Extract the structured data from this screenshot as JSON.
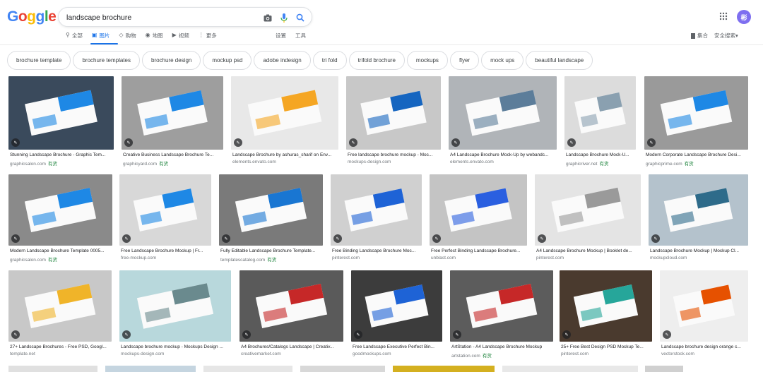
{
  "header": {
    "logo_letters": [
      "G",
      "o",
      "g",
      "g",
      "l",
      "e"
    ],
    "logo_colors": [
      "#4285f4",
      "#ea4335",
      "#fbbc05",
      "#4285f4",
      "#34a853",
      "#ea4335"
    ],
    "search_value": "landscape brochure",
    "search_placeholder": "",
    "avatar_initial": "彬"
  },
  "tabs": [
    {
      "label": "全部",
      "icon": "search-icon"
    },
    {
      "label": "图片",
      "icon": "image-icon",
      "active": true
    },
    {
      "label": "购物",
      "icon": "tag-icon"
    },
    {
      "label": "地图",
      "icon": "pin-icon"
    },
    {
      "label": "视频",
      "icon": "play-icon"
    },
    {
      "label": "更多",
      "icon": "more-icon"
    }
  ],
  "tools": {
    "settings": "设置",
    "tools": "工具"
  },
  "right_tools": {
    "collections": "集合",
    "safesearch": "安全搜索▾"
  },
  "chips": [
    "brochure template",
    "brochure templates",
    "brochure design",
    "mockup psd",
    "adobe indesign",
    "tri fold",
    "trifold brochure",
    "mockups",
    "flyer",
    "mock ups",
    "beautiful landscape"
  ],
  "results": [
    {
      "caption": "Stunning Landscape Brochure - Graphic Tem...",
      "source": "graphicsalon.com",
      "license": "有货",
      "color": "#3a4a5c",
      "accent": "#1e88e5"
    },
    {
      "caption": "Creative Business Landscape Brochure Te...",
      "source": "graphicyard.com",
      "license": "有货",
      "color": "#9e9e9e",
      "accent": "#1e88e5"
    },
    {
      "caption": "Landscape Brochure by ashuras_sharif on Env...",
      "source": "elements.envato.com",
      "license": "",
      "color": "#e8e8e8",
      "accent": "#f5a623"
    },
    {
      "caption": "Free landscape brochure mockup - Moc...",
      "source": "mockups-design.com",
      "license": "",
      "color": "#c8c8c8",
      "accent": "#1565c0"
    },
    {
      "caption": "A4 Landscape Brochure Mock-Up by webandc...",
      "source": "elements.envato.com",
      "license": "",
      "color": "#b0b4b8",
      "accent": "#5c7d9a"
    },
    {
      "caption": "Landscape Brochure Mock-U...",
      "source": "graphicriver.net",
      "license": "有货",
      "color": "#dcdcdc",
      "accent": "#8aa0b0"
    },
    {
      "caption": "Modern Corporate Landscape Brochure Desi...",
      "source": "graphicprime.com",
      "license": "有货",
      "color": "#9a9a9a",
      "accent": "#1e88e5"
    },
    {
      "caption": "Modern Landscape Brochure Template 0005...",
      "source": "graphicsalon.com",
      "license": "有货",
      "color": "#8a8a8a",
      "accent": "#1e88e5"
    },
    {
      "caption": "Free Landscape Brochure Mockup | Fr...",
      "source": "free-mockup.com",
      "license": "",
      "color": "#d8d8d8",
      "accent": "#1e88e5"
    },
    {
      "caption": "Fully Editable Landscape Brochure Template...",
      "source": "templatescatalog.com",
      "license": "有货",
      "color": "#7a7a7a",
      "accent": "#1976d2"
    },
    {
      "caption": "Free Binding Landscape Brochure Moc...",
      "source": "pinterest.com",
      "license": "",
      "color": "#d0d0d0",
      "accent": "#1e63d6"
    },
    {
      "caption": "Free Perfect Binding Landscape Brochure...",
      "source": "unblast.com",
      "license": "",
      "color": "#c4c4c4",
      "accent": "#2a5fe0"
    },
    {
      "caption": "A4 Landscape Brochure Mockup | Booklet de...",
      "source": "pinterest.com",
      "license": "",
      "color": "#e4e4e4",
      "accent": "#9a9a9a"
    },
    {
      "caption": "Landscape Brochure Mockup | Mockup Cl...",
      "source": "mockupcloud.com",
      "license": "",
      "color": "#b4c2cc",
      "accent": "#2e6b8a"
    },
    {
      "caption": "27+ Landscape Brochures - Free PSD, Googl...",
      "source": "template.net",
      "license": "",
      "color": "#c8c8c8",
      "accent": "#f0b429"
    },
    {
      "caption": "Landscape brochure mockup - Mockups Design ...",
      "source": "mockups-design.com",
      "license": "",
      "color": "#b8d8dc",
      "accent": "#6a8a8e"
    },
    {
      "caption": "A4 Brochures/Catalogs Landscape | Creativ...",
      "source": "creativemarket.com",
      "license": "",
      "color": "#5a5a5a",
      "accent": "#c62828"
    },
    {
      "caption": "Free Landscape Executive Perfect Bin...",
      "source": "goodmockups.com",
      "license": "",
      "color": "#3c3c3c",
      "accent": "#1e63d6"
    },
    {
      "caption": "ArtStation - A4 Landscape Brochure Mockup",
      "source": "artstation.com",
      "license": "有货",
      "color": "#5c5c5c",
      "accent": "#c62828"
    },
    {
      "caption": "25+ Free Best Design PSD Mockup Te...",
      "source": "pinterest.com",
      "license": "",
      "color": "#4a3a2e",
      "accent": "#26a69a"
    },
    {
      "caption": "Landscape brochure design orange c...",
      "source": "vectorstock.com",
      "license": "",
      "color": "#eeeeee",
      "accent": "#e65100"
    }
  ]
}
